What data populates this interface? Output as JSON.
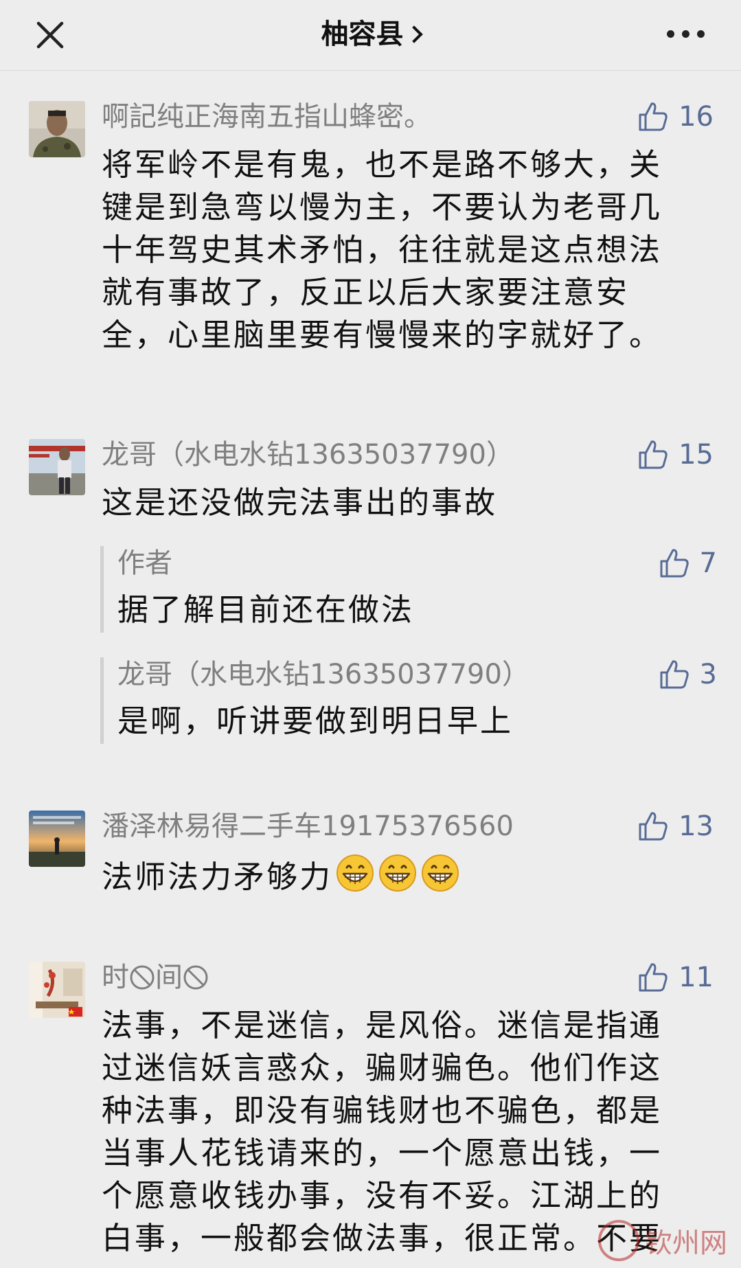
{
  "navbar": {
    "title": "柚容县",
    "close_icon": "close-icon",
    "more_icon": "more-icon"
  },
  "colors": {
    "background": "#ededed",
    "name_gray": "#7f7f7f",
    "like_blue": "#576b95",
    "text": "#111111"
  },
  "comments": [
    {
      "name": "啊記纯正海南五指山蜂密。",
      "likes": "16",
      "lines": [
        "将军岭不是有鬼，也不是路不够大，关",
        "键是到急弯以慢为主，不要认为老哥几",
        "十年驾史其术矛怕，往往就是这点想法",
        "就有事故了，反正以后大家要注意安",
        "全，心里脑里要有慢慢来的字就好了。"
      ]
    },
    {
      "name": "龙哥（水电水钻13635037790）",
      "likes": "15",
      "lines": [
        "这是还没做完法事出的事故"
      ],
      "replies": [
        {
          "name": "作者",
          "likes": "7",
          "text": "据了解目前还在做法"
        },
        {
          "name": "龙哥（水电水钻13635037790）",
          "likes": "3",
          "text": "是啊，听讲要做到明日早上"
        }
      ]
    },
    {
      "name": "潘泽林易得二手车19175376560",
      "likes": "13",
      "text": "法师法力矛够力",
      "emoji": "grinning-face-icon"
    },
    {
      "name_part1": "时",
      "name_part2": "间",
      "likes": "11",
      "lines": [
        "法事，不是迷信，是风俗。迷信是指通",
        "过迷信妖言惑众，骗财骗色。他们作这",
        "种法事，即没有骗钱财也不骗色，都是",
        "当事人花钱请来的，一个愿意出钱，一",
        "个愿意收钱办事，没有不妥。江湖上的",
        "白事，一般都会做法事，很正常。不要"
      ]
    }
  ],
  "watermark": "钦州网"
}
